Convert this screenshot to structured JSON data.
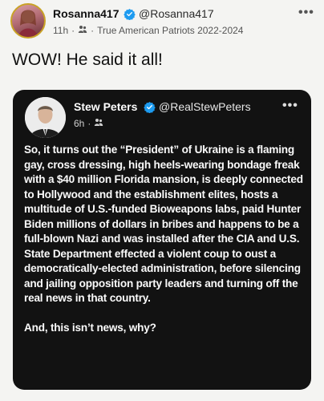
{
  "outer_tweet": {
    "display_name": "Rosanna417",
    "handle": "@Rosanna417",
    "time": "11h",
    "separator": "·",
    "community": "True American Patriots 2022-2024",
    "text": "WOW! He said it all!",
    "more_icon": "more-horizontal-icon",
    "verified_icon": "verified-badge-icon",
    "community_icon": "community-icon"
  },
  "quoted_tweet": {
    "display_name": "Stew Peters",
    "handle": "@RealStewPeters",
    "time": "6h",
    "separator": "·",
    "paragraphs": [
      "So, it turns out the “President” of Ukraine is a flaming gay, cross dressing, high heels-wearing bondage freak with a $40 million Florida mansion, is deeply connected to Hollywood and the establishment elites, hosts a multitude of U.S.-funded Bioweapons labs, paid Hunter Biden millions of dollars in bribes and happens to be a full-blown Nazi and was installed after the CIA and U.S. State Department effected a violent coup to oust a democratically-elected administration, before silencing and jailing opposition party leaders and turning off the real news in that country.",
      "And, this isn’t news, why?"
    ],
    "more_icon": "more-horizontal-icon",
    "verified_icon": "verified-badge-icon",
    "community_icon": "community-icon"
  },
  "colors": {
    "verified_blue": "#1d9bf0",
    "card_background": "#121212",
    "page_background": "#f4f4f2",
    "avatar_ring": "#c9a227"
  }
}
